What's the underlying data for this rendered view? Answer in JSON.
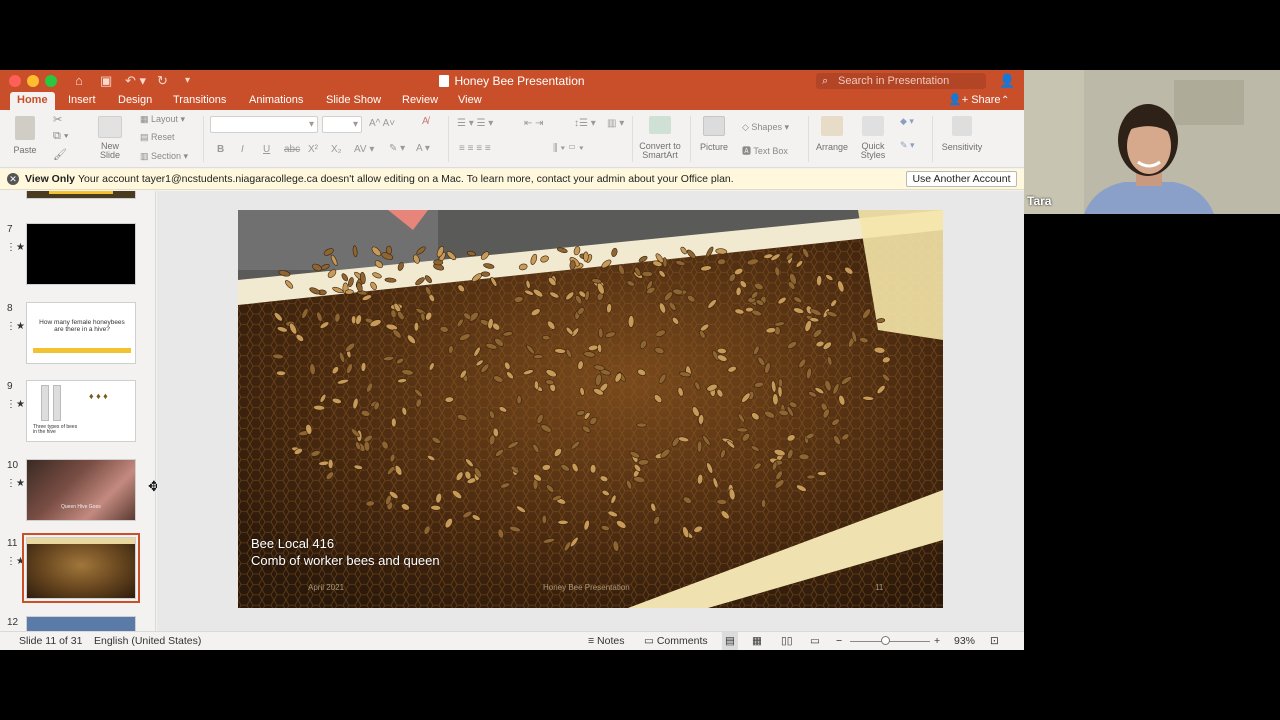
{
  "window": {
    "title": "Honey Bee Presentation",
    "search_placeholder": "Search in Presentation"
  },
  "tabs": [
    "Home",
    "Insert",
    "Design",
    "Transitions",
    "Animations",
    "Slide Show",
    "Review",
    "View"
  ],
  "share_label": "Share",
  "ribbon": {
    "paste": "Paste",
    "new_slide": "New\nSlide",
    "layout": "Layout",
    "reset": "Reset",
    "section": "Section",
    "convert_smartart": "Convert to\nSmartArt",
    "picture": "Picture",
    "shapes": "Shapes",
    "text_box": "Text Box",
    "arrange": "Arrange",
    "quick_styles": "Quick\nStyles",
    "sensitivity": "Sensitivity",
    "bold": "B",
    "italic": "I",
    "underline": "U",
    "strike": "abc",
    "superscript": "X²",
    "subscript": "X₂"
  },
  "message_bar": {
    "title": "View Only",
    "text": "Your account tayer1@ncstudents.niagaracollege.ca doesn't allow editing on a Mac. To learn more, contact your admin about your Office plan.",
    "button": "Use Another Account"
  },
  "thumbnails": [
    {
      "num": "7",
      "kind": "black"
    },
    {
      "num": "8",
      "kind": "question",
      "text": "How many female honeybees are there in a hive?"
    },
    {
      "num": "9",
      "kind": "types",
      "caption": "Three types of bees in the hive"
    },
    {
      "num": "10",
      "kind": "photo",
      "caption": "Queen Hive Goes"
    },
    {
      "num": "11",
      "kind": "bees",
      "selected": true
    },
    {
      "num": "12",
      "kind": "blue"
    }
  ],
  "slide": {
    "caption_line1": "Bee Local 416",
    "caption_line2": "Comb of worker bees and queen",
    "footer_date": "April 2021",
    "footer_center": "Honey Bee Presentation",
    "footer_num": "11"
  },
  "status": {
    "slide_info": "Slide 11 of 31",
    "language": "English (United States)",
    "notes": "Notes",
    "comments": "Comments",
    "zoom": "93%",
    "zoom_level_percent": 93
  },
  "video": {
    "participant": "Tara"
  },
  "colors": {
    "accent": "#c94f2a",
    "message_bg": "#fff8dc"
  }
}
